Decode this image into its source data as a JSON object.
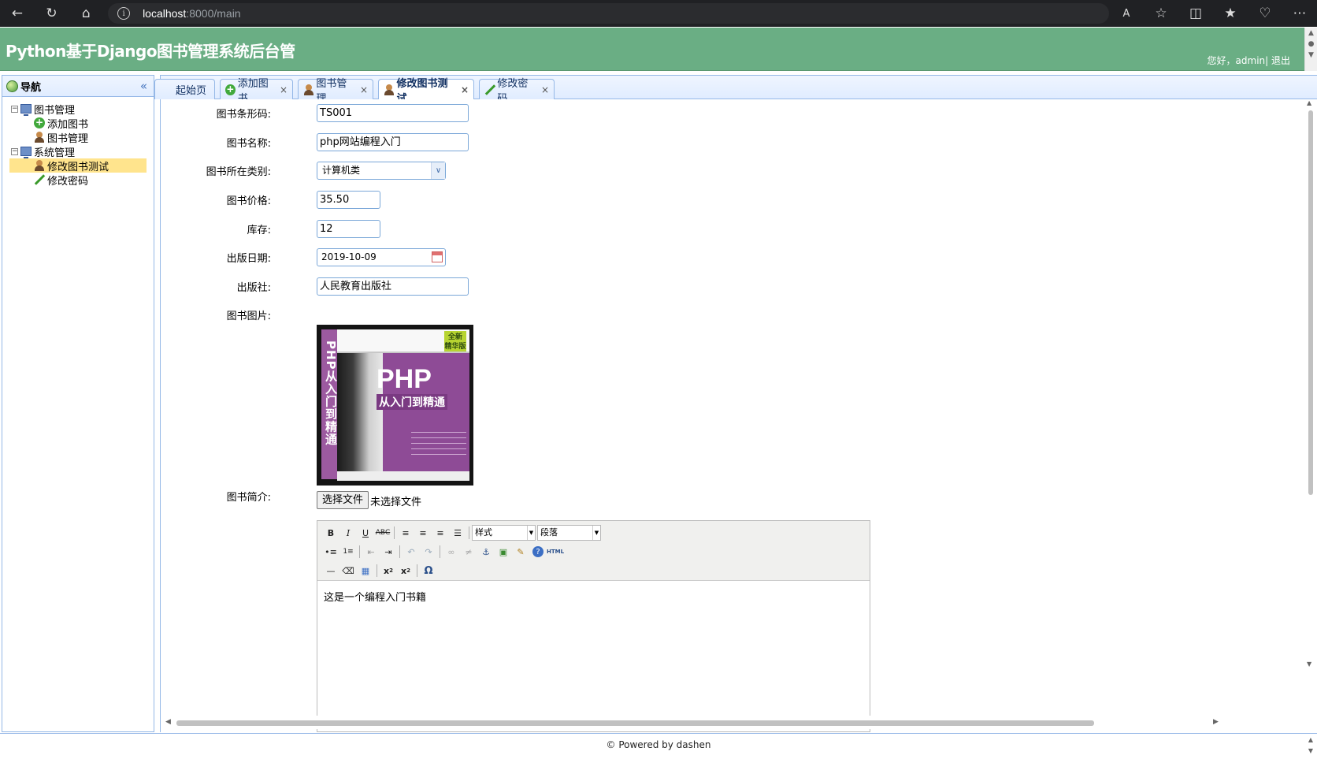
{
  "browser": {
    "url_host": "localhost",
    "url_path": ":8000/main"
  },
  "header": {
    "title": "Python基于Django图书管理系统后台管",
    "user_text": "您好，admin| 退出"
  },
  "nav": {
    "title": "导航",
    "collapse_glyph": "«",
    "groups": [
      {
        "label": "图书管理",
        "items": [
          {
            "label": "添加图书"
          },
          {
            "label": "图书管理"
          }
        ]
      },
      {
        "label": "系统管理",
        "items": [
          {
            "label": "修改图书测试"
          },
          {
            "label": "修改密码"
          }
        ]
      }
    ]
  },
  "tabs": [
    {
      "label": "起始页",
      "closable": false
    },
    {
      "label": "添加图书",
      "closable": true
    },
    {
      "label": "图书管理",
      "closable": true
    },
    {
      "label": "修改图书测试",
      "closable": true,
      "active": true
    },
    {
      "label": "修改密码",
      "closable": true
    }
  ],
  "form": {
    "barcode": {
      "label": "图书条形码:",
      "value": "TS001"
    },
    "name": {
      "label": "图书名称:",
      "value": "php网站编程入门"
    },
    "category": {
      "label": "图书所在类别:",
      "value": "计算机类"
    },
    "price": {
      "label": "图书价格:",
      "value": "35.50"
    },
    "stock": {
      "label": "库存:",
      "value": "12"
    },
    "publish_date": {
      "label": "出版日期:",
      "value": "2019-10-09"
    },
    "publisher": {
      "label": "出版社:",
      "value": "人民教育出版社"
    },
    "photo": {
      "label": "图书图片:",
      "choose_button": "选择文件",
      "no_file_text": "未选择文件",
      "cover_title": "PHP",
      "cover_subtitle": "从入门到精通",
      "cover_spine": "PHP从入门到精通",
      "cover_badge": "全新 精华版"
    },
    "description": {
      "label": "图书简介:",
      "content": "这是一个编程入门书籍",
      "style_select": "样式",
      "paragraph_select": "段落"
    }
  },
  "footer": {
    "text": "© Powered by dashen"
  },
  "colors": {
    "header_bg": "#6aae84",
    "panel_border": "#95b8e7",
    "selected_row": "#ffe48d"
  }
}
